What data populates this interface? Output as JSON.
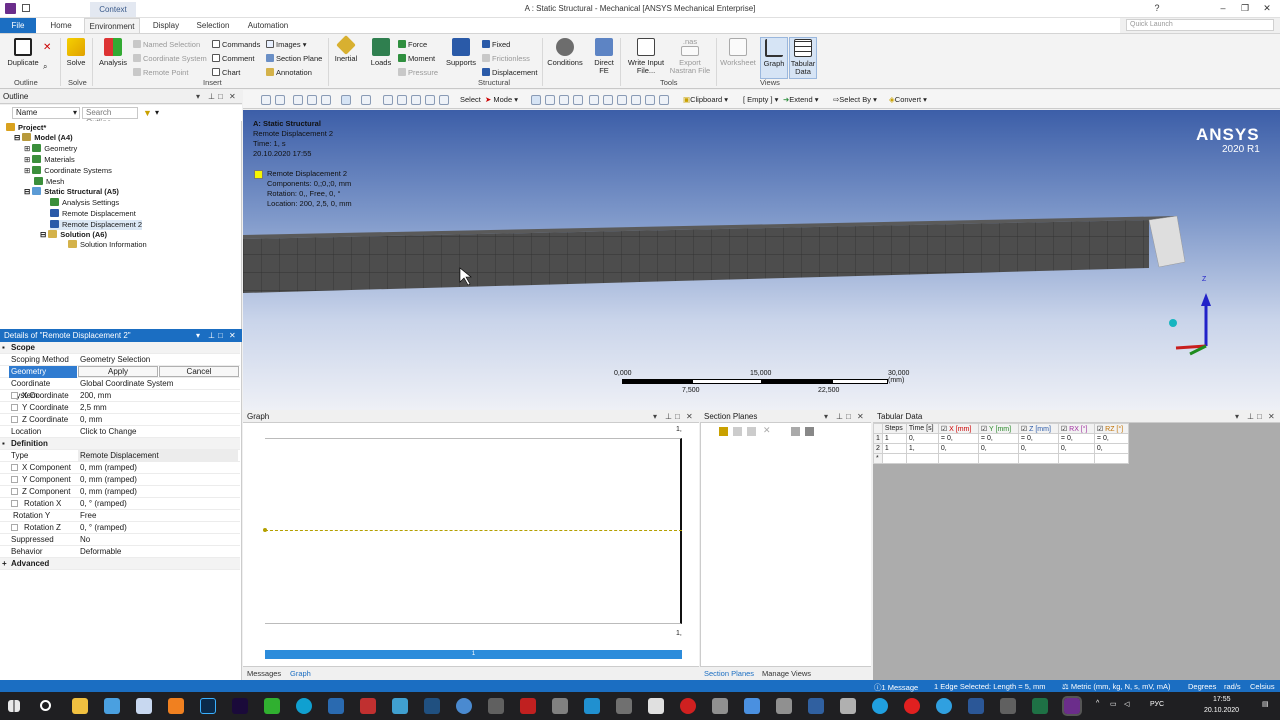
{
  "titlebar": {
    "context_tab": "Context",
    "title": "A : Static Structural - Mechanical [ANSYS Mechanical Enterprise]",
    "quick_launch_placeholder": "Quick Launch",
    "minimize": "–",
    "maximize": "❐",
    "close": "✕",
    "help": "?"
  },
  "tabs": {
    "file": "File",
    "home": "Home",
    "environment": "Environment",
    "display": "Display",
    "selection": "Selection",
    "automation": "Automation"
  },
  "ribbon": {
    "duplicate": "Duplicate",
    "outline_group": "Outline",
    "solve": "Solve",
    "solve_group": "Solve",
    "analysis": "Analysis",
    "named_selection": "Named Selection",
    "coordinate_system": "Coordinate System",
    "remote_point": "Remote Point",
    "commands": "Commands",
    "comment": "Comment",
    "chart": "Chart",
    "images": "Images",
    "section_plane": "Section Plane",
    "annotation": "Annotation",
    "insert_group": "Insert",
    "inertial": "Inertial",
    "loads": "Loads",
    "force": "Force",
    "moment": "Moment",
    "pressure": "Pressure",
    "supports": "Supports",
    "fixed": "Fixed",
    "frictionless": "Frictionless",
    "displacement": "Displacement",
    "structural_group": "Structural",
    "conditions": "Conditions",
    "direct_fe_1": "Direct",
    "direct_fe_2": "FE",
    "write_input_1": "Write Input",
    "write_input_2": "File...",
    "export_nastran_0": ".nas",
    "export_nastran_1": "Export",
    "export_nastran_2": "Nastran File",
    "tools_group": "Tools",
    "worksheet": "Worksheet",
    "graph": "Graph",
    "tabular_data_1": "Tabular",
    "tabular_data_2": "Data",
    "views_group": "Views"
  },
  "outline": {
    "header": "Outline",
    "name_dropdown": "Name",
    "search_placeholder": "Search Outline",
    "tree": [
      {
        "label": "Project*"
      },
      {
        "label": "Model (A4)"
      },
      {
        "label": "Geometry"
      },
      {
        "label": "Materials"
      },
      {
        "label": "Coordinate Systems"
      },
      {
        "label": "Mesh"
      },
      {
        "label": "Static Structural (A5)"
      },
      {
        "label": "Analysis Settings"
      },
      {
        "label": "Remote Displacement"
      },
      {
        "label": "Remote Displacement 2"
      },
      {
        "label": "Solution (A6)"
      },
      {
        "label": "Solution Information"
      }
    ]
  },
  "details": {
    "header": "Details of \"Remote Displacement 2\"",
    "scope": "Scope",
    "scoping_method_k": "Scoping Method",
    "scoping_method_v": "Geometry Selection",
    "geometry_k": "Geometry",
    "apply": "Apply",
    "cancel": "Cancel",
    "coord_sys_k": "Coordinate System",
    "coord_sys_v": "Global Coordinate System",
    "x_coord_k": "X Coordinate",
    "x_coord_v": "200, mm",
    "y_coord_k": "Y Coordinate",
    "y_coord_v": "2,5 mm",
    "z_coord_k": "Z Coordinate",
    "z_coord_v": "0, mm",
    "location_k": "Location",
    "location_v": "Click to Change",
    "definition": "Definition",
    "type_k": "Type",
    "type_v": "Remote Displacement",
    "xc_k": "X Component",
    "xc_v": "0, mm  (ramped)",
    "yc_k": "Y Component",
    "yc_v": "0, mm  (ramped)",
    "zc_k": "Z Component",
    "zc_v": "0, mm  (ramped)",
    "rx_k": "Rotation X",
    "rx_v": "0, °  (ramped)",
    "ry_k": "Rotation Y",
    "ry_v": "Free",
    "rz_k": "Rotation Z",
    "rz_v": "0, °  (ramped)",
    "suppressed_k": "Suppressed",
    "suppressed_v": "No",
    "behavior_k": "Behavior",
    "behavior_v": "Deformable",
    "advanced": "Advanced"
  },
  "viewtools": {
    "select": "Select",
    "mode": "Mode",
    "clipboard": "Clipboard",
    "empty": "[ Empty ]",
    "extend": "Extend",
    "select_by": "Select By",
    "convert": "Convert"
  },
  "viewport": {
    "info_title": "A: Static Structural",
    "info_name": "Remote Displacement 2",
    "info_time": "Time: 1, s",
    "info_date": "20.10.2020 17:55",
    "legend_name": "Remote Displacement 2",
    "legend_components": "Components: 0,;0,;0, mm",
    "legend_rotation": "Rotation: 0,, Free, 0, °",
    "legend_location": "Location: 200, 2,5, 0, mm",
    "logo": "ANSYS",
    "version": "2020 R1",
    "scale_0": "0,000",
    "scale_15": "15,000",
    "scale_30": "30,000 (mm)",
    "scale_75": "7,500",
    "scale_225": "22,500",
    "axis_z": "Z"
  },
  "graph": {
    "header": "Graph",
    "y_top": "1,",
    "x_right": "1,",
    "bar_label": "1",
    "tab_messages": "Messages",
    "tab_graph": "Graph"
  },
  "section_planes": {
    "header": "Section Planes",
    "tab_section": "Section Planes",
    "tab_views": "Manage Views"
  },
  "tabular": {
    "header": "Tabular Data",
    "cols": [
      "Steps",
      "Time [s]",
      "X [mm]",
      "Y [mm]",
      "Z [mm]",
      "RX [°]",
      "RZ [°]"
    ],
    "rows": [
      {
        "idx": "1",
        "step": "1",
        "time": "0,",
        "x": "= 0,",
        "y": "= 0,",
        "z": "= 0,",
        "rx": "= 0,",
        "rz": "= 0,"
      },
      {
        "idx": "2",
        "step": "1",
        "time": "1,",
        "x": "0,",
        "y": "0,",
        "z": "0,",
        "rx": "0,",
        "rz": "0,"
      }
    ]
  },
  "statusbar": {
    "messages": "1 Message",
    "edge": "1 Edge Selected: Length = 5, mm",
    "units": "Metric (mm, kg, N, s, mV, mA)",
    "degrees": "Degrees",
    "rads": "rad/s",
    "celsius": "Celsius"
  },
  "taskbar": {
    "lang": "РУС",
    "time": "17:55",
    "date": "20.10.2020"
  }
}
